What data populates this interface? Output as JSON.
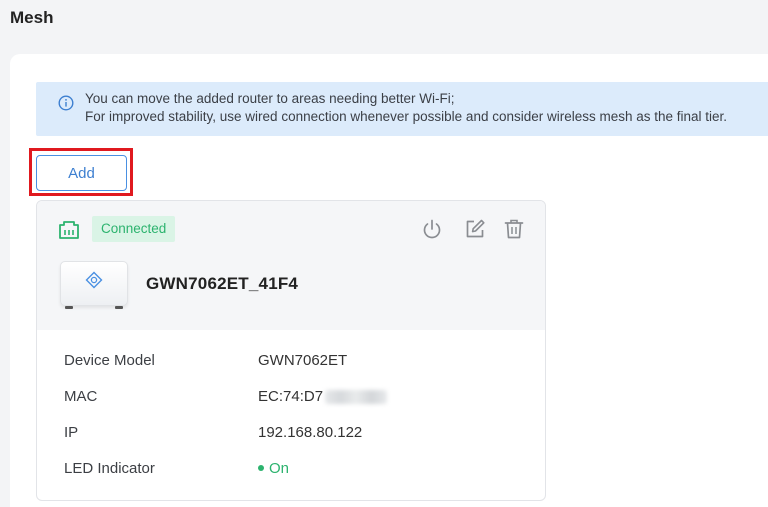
{
  "page": {
    "title": "Mesh"
  },
  "info": {
    "line1": "You can move the added router to areas needing better Wi-Fi;",
    "line2": "For improved stability, use wired connection whenever possible and consider wireless mesh as the final tier."
  },
  "toolbar": {
    "add_label": "Add"
  },
  "device": {
    "status": "Connected",
    "name": "GWN7062ET_41F4",
    "fields": [
      {
        "label": "Device Model",
        "value": "GWN7062ET"
      },
      {
        "label": "MAC",
        "value": "EC:74:D7"
      },
      {
        "label": "IP",
        "value": "192.168.80.122"
      },
      {
        "label": "LED Indicator",
        "value": "On"
      }
    ]
  },
  "colors": {
    "accent": "#4a90e2",
    "status_green": "#2cb36e",
    "banner_bg": "#dcebfb",
    "highlight_red": "#e0191f"
  }
}
